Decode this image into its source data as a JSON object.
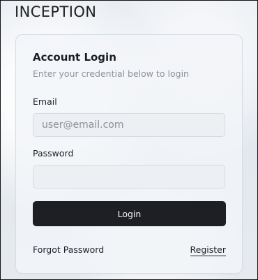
{
  "app": {
    "title": "INCEPTION"
  },
  "login": {
    "title": "Account Login",
    "subtitle": "Enter your credential below to login",
    "email_label": "Email",
    "email_placeholder": "user@email.com",
    "password_label": "Password",
    "password_placeholder": "",
    "login_button": "Login",
    "forgot_password": "Forgot Password",
    "register": "Register"
  }
}
